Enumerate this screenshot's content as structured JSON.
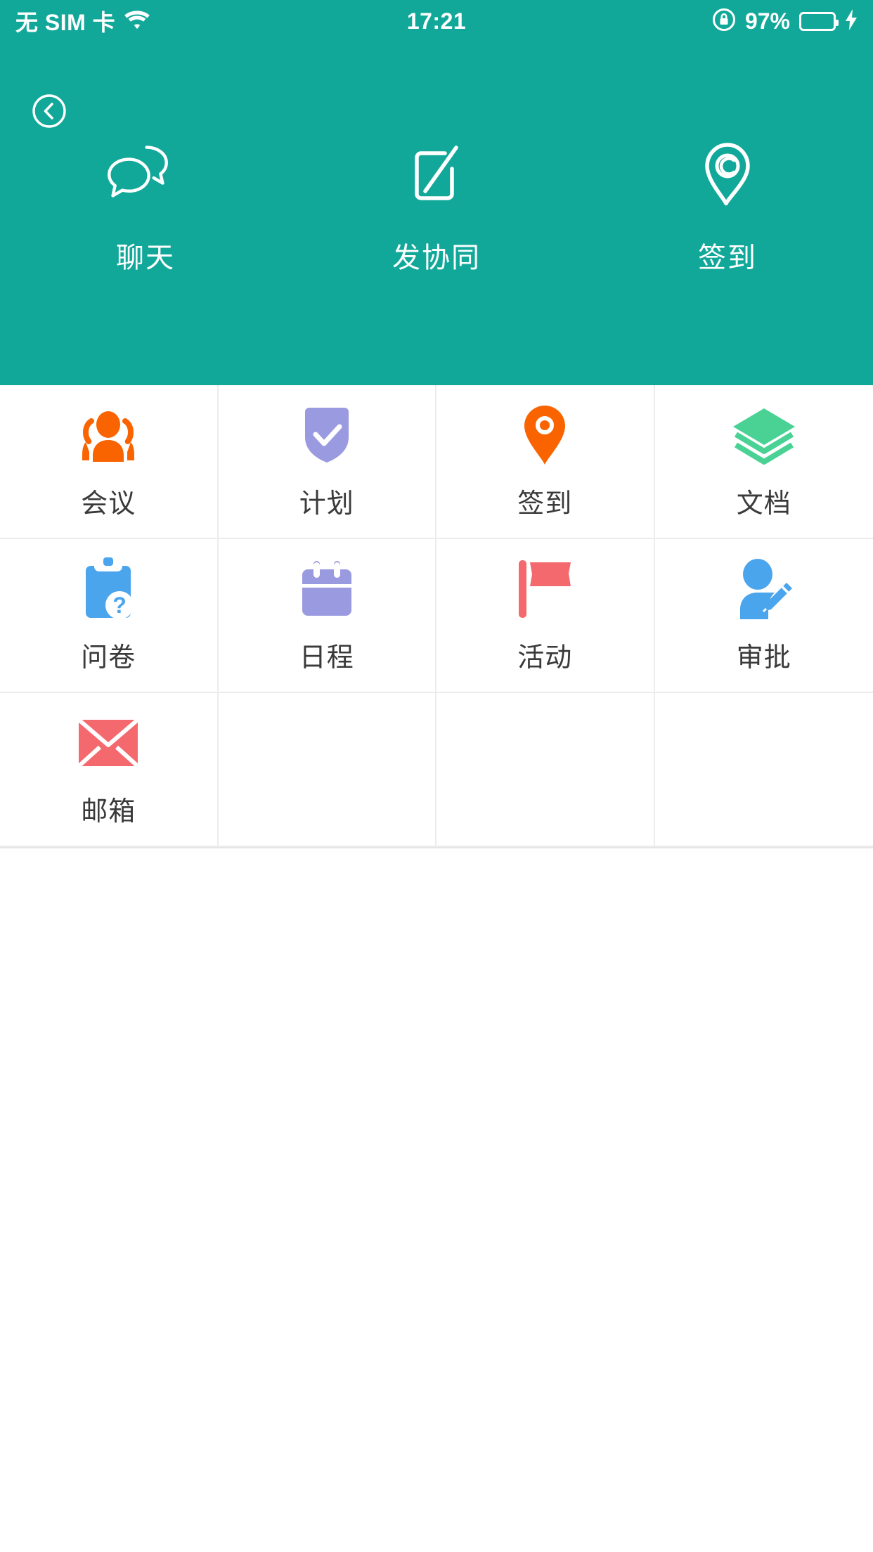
{
  "status_bar": {
    "carrier": "无 SIM 卡",
    "wifi_icon": "wifi-icon",
    "time": "17:21",
    "rotation_lock_icon": "rotation-lock-icon",
    "battery_percent": "97%",
    "battery_level": 97,
    "battery_icon": "battery-icon",
    "charging_icon": "charging-bolt-icon"
  },
  "header": {
    "background_color": "#11a89a",
    "back_button": {
      "name": "back-button",
      "icon": "chevron-left-circle-icon"
    },
    "quick_actions": [
      {
        "label": "聊天",
        "icon": "chat-bubbles-icon"
      },
      {
        "label": "发协同",
        "icon": "compose-note-icon"
      },
      {
        "label": "签到",
        "icon": "location-pin-outline-icon"
      }
    ]
  },
  "app_grid": {
    "columns": 4,
    "items": [
      {
        "label": "会议",
        "icon": "group-people-icon",
        "color": "#fa6400"
      },
      {
        "label": "计划",
        "icon": "shield-check-icon",
        "color": "#9a9ae0"
      },
      {
        "label": "签到",
        "icon": "location-pin-solid-icon",
        "color": "#fa6400"
      },
      {
        "label": "文档",
        "icon": "layers-stack-icon",
        "color": "#4ad295"
      },
      {
        "label": "问卷",
        "icon": "clipboard-question-icon",
        "color": "#4ba5ed"
      },
      {
        "label": "日程",
        "icon": "calendar-icon",
        "color": "#9a9ae0"
      },
      {
        "label": "活动",
        "icon": "flag-icon",
        "color": "#f4696d"
      },
      {
        "label": "审批",
        "icon": "person-pencil-icon",
        "color": "#4ba5ed"
      },
      {
        "label": "邮箱",
        "icon": "envelope-icon",
        "color": "#f4696d"
      }
    ]
  }
}
